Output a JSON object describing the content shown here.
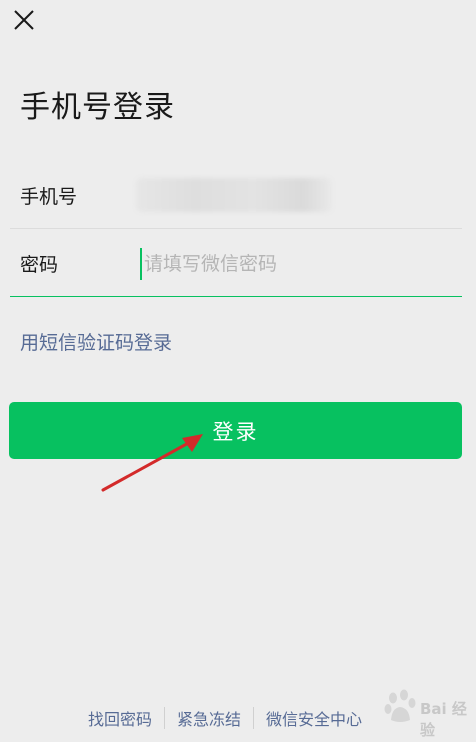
{
  "header": {
    "close_icon": "close-icon"
  },
  "title": "手机号登录",
  "form": {
    "phone_label": "手机号",
    "password_label": "密码",
    "password_placeholder": "请填写微信密码"
  },
  "sms_login_link": "用短信验证码登录",
  "login_button": "登录",
  "footer": {
    "links": [
      "找回密码",
      "紧急冻结",
      "微信安全中心"
    ]
  },
  "watermark": {
    "text": "Bai 经验"
  },
  "colors": {
    "accent_green": "#07c160",
    "link_blue": "#576b95",
    "background": "#ededed",
    "annotation_red": "#d32a2a"
  }
}
